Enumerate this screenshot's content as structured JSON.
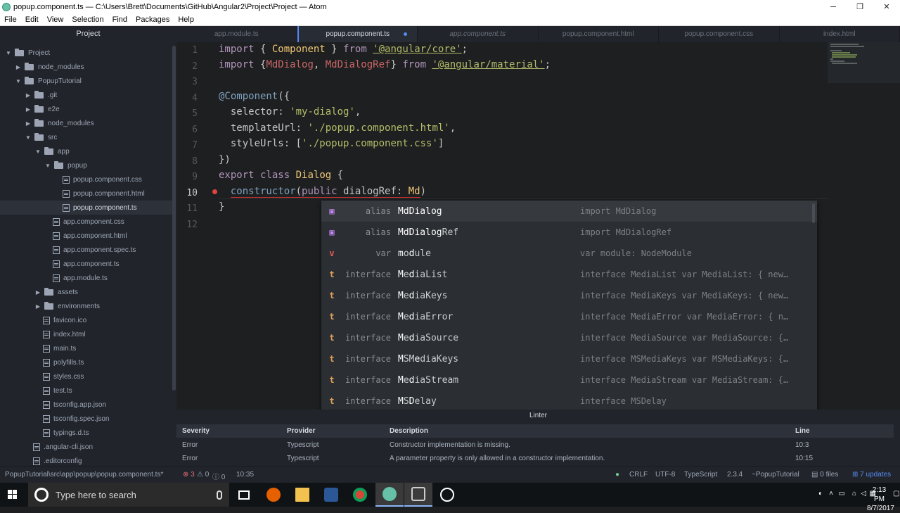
{
  "window": {
    "title": "popup.component.ts — C:\\Users\\Brett\\Documents\\GitHub\\Angular2\\Project\\Project — Atom",
    "minimize": "─",
    "maximize": "❐",
    "close": "✕"
  },
  "menu": [
    "File",
    "Edit",
    "View",
    "Selection",
    "Find",
    "Packages",
    "Help"
  ],
  "tree": {
    "header": "Project",
    "items": [
      {
        "label": "Project",
        "kind": "folder",
        "depth": 0,
        "expanded": true
      },
      {
        "label": "node_modules",
        "kind": "folder",
        "depth": 1,
        "expanded": false
      },
      {
        "label": "PopupTutorial",
        "kind": "folder",
        "depth": 1,
        "expanded": true
      },
      {
        "label": ".git",
        "kind": "folder",
        "depth": 2,
        "expanded": false
      },
      {
        "label": "e2e",
        "kind": "folder",
        "depth": 2,
        "expanded": false
      },
      {
        "label": "node_modules",
        "kind": "folder",
        "depth": 2,
        "expanded": false
      },
      {
        "label": "src",
        "kind": "folder",
        "depth": 2,
        "expanded": true
      },
      {
        "label": "app",
        "kind": "folder",
        "depth": 3,
        "expanded": true
      },
      {
        "label": "popup",
        "kind": "folder",
        "depth": 4,
        "expanded": true
      },
      {
        "label": "popup.component.css",
        "kind": "file",
        "depth": 5
      },
      {
        "label": "popup.component.html",
        "kind": "file",
        "depth": 5
      },
      {
        "label": "popup.component.ts",
        "kind": "file",
        "depth": 5,
        "selected": true
      },
      {
        "label": "app.component.css",
        "kind": "file",
        "depth": 4
      },
      {
        "label": "app.component.html",
        "kind": "file",
        "depth": 4
      },
      {
        "label": "app.component.spec.ts",
        "kind": "file",
        "depth": 4
      },
      {
        "label": "app.component.ts",
        "kind": "file",
        "depth": 4
      },
      {
        "label": "app.module.ts",
        "kind": "file",
        "depth": 4
      },
      {
        "label": "assets",
        "kind": "folder",
        "depth": 3,
        "expanded": false
      },
      {
        "label": "environments",
        "kind": "folder",
        "depth": 3,
        "expanded": false
      },
      {
        "label": "favicon.ico",
        "kind": "file",
        "depth": 3
      },
      {
        "label": "index.html",
        "kind": "file",
        "depth": 3
      },
      {
        "label": "main.ts",
        "kind": "file",
        "depth": 3
      },
      {
        "label": "polyfills.ts",
        "kind": "file",
        "depth": 3
      },
      {
        "label": "styles.css",
        "kind": "file",
        "depth": 3
      },
      {
        "label": "test.ts",
        "kind": "file",
        "depth": 3
      },
      {
        "label": "tsconfig.app.json",
        "kind": "file",
        "depth": 3
      },
      {
        "label": "tsconfig.spec.json",
        "kind": "file",
        "depth": 3
      },
      {
        "label": "typings.d.ts",
        "kind": "file",
        "depth": 3
      },
      {
        "label": ".angular-cli.json",
        "kind": "file",
        "depth": 2
      },
      {
        "label": ".editorconfig",
        "kind": "file",
        "depth": 2
      }
    ]
  },
  "tabs": [
    {
      "label": "app.module.ts",
      "active": false,
      "italic": false
    },
    {
      "label": "popup.component.ts",
      "active": true,
      "modified": true
    },
    {
      "label": "app.component.ts",
      "active": false,
      "italic": true
    },
    {
      "label": "popup.component.html",
      "active": false
    },
    {
      "label": "popup.component.css",
      "active": false
    },
    {
      "label": "index.html",
      "active": false
    }
  ],
  "editor": {
    "line_numbers": [
      "1",
      "2",
      "3",
      "4",
      "5",
      "6",
      "7",
      "8",
      "9",
      "10",
      "11",
      "12"
    ],
    "current_line": "10",
    "code": {
      "l1": {
        "kw": "import",
        "p1": " { ",
        "cls": "Component",
        "p2": " } ",
        "from": "from",
        "sp": " ",
        "str": "'@angular/core'",
        "end": ";"
      },
      "l2": {
        "kw": "import",
        "p1": " {",
        "c1": "MdDialog",
        "comma": ", ",
        "c2": "MdDialogRef",
        "p2": "} ",
        "from": "from",
        "sp": " ",
        "str": "'@angular/material'",
        "end": ";"
      },
      "l4": {
        "dec": "@Component",
        "rest": "({"
      },
      "l5": {
        "key": "  selector: ",
        "str": "'my-dialog'",
        "end": ","
      },
      "l6": {
        "key": "  templateUrl: ",
        "str": "'./popup.component.html'",
        "end": ","
      },
      "l7": {
        "key": "  styleUrls: [",
        "str": "'./popup.component.css'",
        "end": "]"
      },
      "l8": {
        "text": "})"
      },
      "l9": {
        "kw1": "export",
        "sp1": " ",
        "kw2": "class",
        "sp2": " ",
        "cls": "Dialog",
        "rest": " {"
      },
      "l10": {
        "indent": "  ",
        "fn": "constructor",
        "p1": "(",
        "kw": "public",
        "sp": " ",
        "prm": "dialogRef",
        "colon": ": ",
        "typed": "Md",
        "p2": ")"
      },
      "l11": {
        "text": "}"
      }
    }
  },
  "autocomplete": [
    {
      "icon": "package",
      "glyph": "▣",
      "type": "alias",
      "match": "MdDialog",
      "rest": "",
      "desc": "import MdDialog"
    },
    {
      "icon": "package",
      "glyph": "▣",
      "type": "alias",
      "match": "MdDialog",
      "rest": "Ref",
      "desc": "import MdDialogRef"
    },
    {
      "icon": "variable",
      "glyph": "v",
      "type": "var",
      "match": "m",
      "rest": "o",
      "match2": "d",
      "rest2": "ule",
      "desc": "var module: NodeModule"
    },
    {
      "icon": "type",
      "glyph": "t",
      "type": "interface",
      "match": "M",
      "rest": "e",
      "match2": "d",
      "rest2": "iaList",
      "desc": "interface MediaList var MediaList: { new…"
    },
    {
      "icon": "type",
      "glyph": "t",
      "type": "interface",
      "match": "M",
      "rest": "e",
      "match2": "d",
      "rest2": "iaKeys",
      "desc": "interface MediaKeys var MediaKeys: { new…"
    },
    {
      "icon": "type",
      "glyph": "t",
      "type": "interface",
      "match": "M",
      "rest": "e",
      "match2": "d",
      "rest2": "iaError",
      "desc": "interface MediaError var MediaError: { n…"
    },
    {
      "icon": "type",
      "glyph": "t",
      "type": "interface",
      "match": "M",
      "rest": "e",
      "match2": "d",
      "rest2": "iaSource",
      "desc": "interface MediaSource var MediaSource: {…"
    },
    {
      "icon": "type",
      "glyph": "t",
      "type": "interface",
      "match": "M",
      "rest": "SM",
      "match2": "e",
      "rest2": "diaKeys",
      "desc": "interface MSMediaKeys var MSMediaKeys: {…"
    },
    {
      "icon": "type",
      "glyph": "t",
      "type": "interface",
      "match": "M",
      "rest": "e",
      "match2": "d",
      "rest2": "iaStream",
      "desc": "interface MediaStream var MediaStream: {…"
    },
    {
      "icon": "type",
      "glyph": "t",
      "type": "interface",
      "match": "M",
      "rest": "S",
      "match2": "D",
      "rest2": "elay",
      "desc": "interface MSDelay"
    }
  ],
  "linter": {
    "title": "Linter",
    "columns": [
      "Severity",
      "Provider",
      "Description",
      "Line"
    ],
    "rows": [
      {
        "severity": "Error",
        "provider": "Typescript",
        "description": "Constructor implementation is missing.",
        "line": "10:3"
      },
      {
        "severity": "Error",
        "provider": "Typescript",
        "description": "A parameter property is only allowed in a constructor implementation.",
        "line": "10:15"
      }
    ]
  },
  "status": {
    "path": "PopupTutorial\\src\\app\\popup\\popup.component.ts*",
    "errors": "3",
    "warnings": "0",
    "infos": "0",
    "cursor": "10:35",
    "line_ending": "CRLF",
    "encoding": "UTF-8",
    "grammar": "TypeScript",
    "ts_version": "2.3.4",
    "project": "~PopupTutorial",
    "files": "0 files",
    "updates": "7 updates"
  },
  "taskbar": {
    "search_placeholder": "Type here to search",
    "time": "2:13 PM",
    "date": "8/7/2017"
  },
  "colors": {
    "accent": "#568af2",
    "error": "#e0443e"
  }
}
